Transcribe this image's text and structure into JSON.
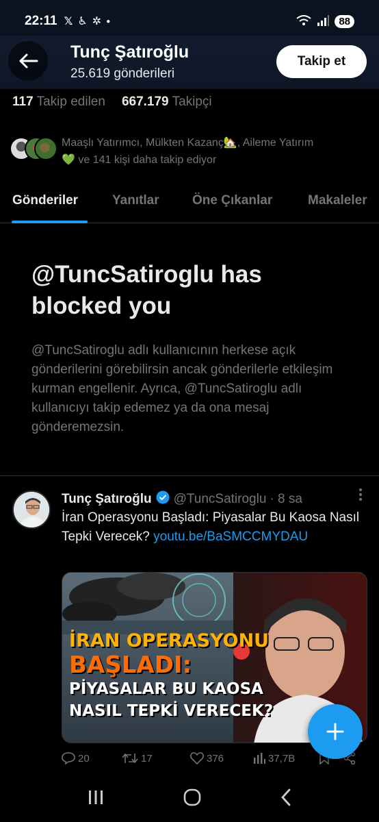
{
  "status_bar": {
    "time": "22:11",
    "left_icons": [
      "x-icon",
      "accessibility-icon",
      "fan-icon",
      "dot-icon"
    ],
    "battery": "88"
  },
  "header": {
    "name": "Tunç Şatıroğlu",
    "posts_count": "25.619 gönderileri",
    "follow_label": "Takip et"
  },
  "stats": {
    "following_count": "117",
    "following_label": "Takip edilen",
    "followers_count": "667.179",
    "followers_label": "Takipçi"
  },
  "followed_by": {
    "text_line1": "Maaşlı Yatırımcı, Mülkten Kazanç🏡, Aileme Yatırım",
    "text_line2": "💚 ve 141 kişi daha takip ediyor"
  },
  "tabs": [
    {
      "label": "Gönderiler",
      "active": true
    },
    {
      "label": "Yanıtlar",
      "active": false
    },
    {
      "label": "Öne Çıkanlar",
      "active": false
    },
    {
      "label": "Makaleler",
      "active": false
    }
  ],
  "blocked": {
    "title": "@TuncSatiroglu has blocked you",
    "description": "@TuncSatiroglu adlı kullanıcının herkese açık gönderilerini görebilirsin ancak gönderilerle etkileşim kurman engellenir. Ayrıca, @TuncSatiroglu adlı kullanıcıyı takip edemez ya da ona mesaj gönderemezsin."
  },
  "tweet": {
    "name": "Tunç Şatıroğlu",
    "handle": "@TuncSatiroglu",
    "time": "· 8 sa",
    "text": "İran Operasyonu Başladı: Piyasalar Bu Kaosa Nasıl Tepki Verecek? ",
    "link": "youtu.be/BaSMCCMYDAU",
    "media": {
      "line1": "İRAN OPERASYONU",
      "line2": "BAŞLADI:",
      "line3": "PİYASALAR BU KAOSA",
      "line4": "NASIL TEPKİ VERECEK?"
    },
    "replies": "20",
    "reposts": "17",
    "likes": "376",
    "views": "37,7B"
  },
  "colors": {
    "accent": "#1d9bf0",
    "background": "#000000",
    "text_primary": "#e7e9ea",
    "text_secondary": "#71767b"
  }
}
